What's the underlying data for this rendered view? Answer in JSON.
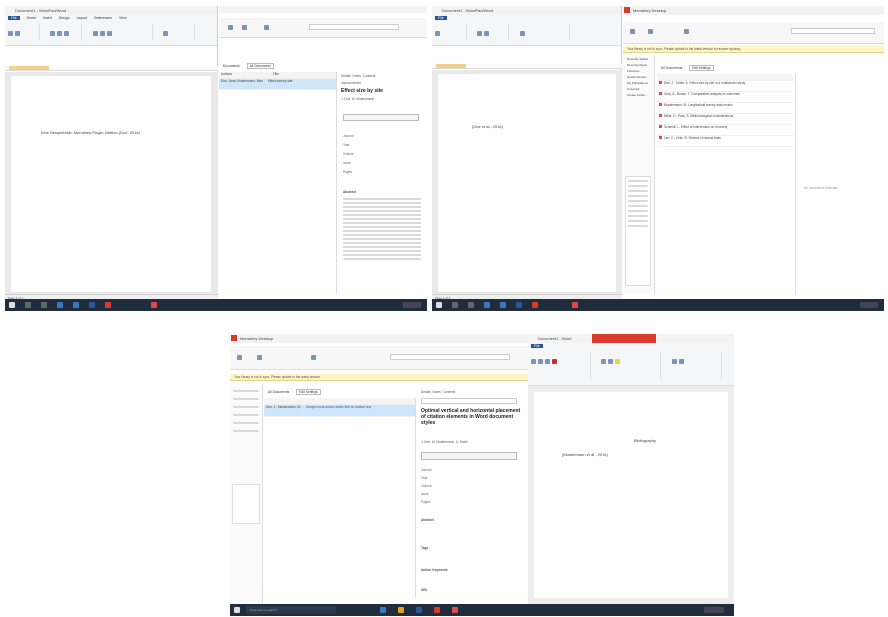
{
  "panel1": {
    "word_title": "Document1 - WordPad/Word",
    "word_tabs": [
      "File",
      "Home",
      "Insert",
      "Design",
      "Layout",
      "References",
      "Mailings",
      "Review",
      "View"
    ],
    "doc_text": "Eine Beispielzitat: Mendeley-Plugin Zitation (Doe, 2016)",
    "mendeley_tabs": [
      "Documents",
      "All Documents"
    ],
    "list_header": [
      "Authors",
      "Title"
    ],
    "list_row": {
      "authors": "Doe, Jane; Mustermann, Max",
      "title": "Effect size by site"
    },
    "details_tabs": [
      "Details",
      "Notes",
      "Contents"
    ],
    "details_title": "Effect size by site",
    "details_type": "Journal Article",
    "details_authors": "J. Doe, M. Mustermann",
    "details_fields": [
      "Journal",
      "Year",
      "Volume",
      "Issue",
      "Pages"
    ],
    "abstract_heading": "Abstract"
  },
  "panel2": {
    "word_title": "Document1 - WordPad/Word",
    "doc_text": "(Doe et al., 2016)",
    "mendeley_title": "Mendeley Desktop",
    "banner": "Your library is not in sync. Please update to the latest version to resume syncing.",
    "tabs": [
      "All Documents",
      "Edit Settings"
    ],
    "rows": [
      {
        "authors": "Doe, J.; Smith, A.",
        "title": "Effect size by site in a multicenter study"
      },
      {
        "authors": "Gray, A.; Brown, T.",
        "title": "Comparative analysis of outcomes"
      },
      {
        "authors": "Mustermann, M.",
        "title": "Longitudinal survey data review"
      },
      {
        "authors": "Miller, K.; Park, S.",
        "title": "Methodological considerations"
      },
      {
        "authors": "Schmidt, L.",
        "title": "Effect of intervention on recovery"
      },
      {
        "authors": "Lee, C.; Ortiz, R.",
        "title": "Review of clinical trials"
      }
    ],
    "no_docs_msg": "No documents selected",
    "sidebar": [
      "Recently Added",
      "Recently Read",
      "Favorites",
      "Needs Review",
      "My Publications",
      "Unsorted",
      "Create Folder..."
    ]
  },
  "panel3": {
    "mendeley_title": "Mendeley Desktop",
    "banner": "Your library is not in sync. Please update to the latest version.",
    "tabs": [
      "All Documents",
      "Edit Settings"
    ],
    "row": {
      "authors": "Doe, J.; Mustermann, M.",
      "title": "Sample multi-author article title for citation test"
    },
    "details_title": "Optimal vertical and horizontal placement of citation elements in Word document styles",
    "details_authors": "J. Doe, M. Mustermann, A. Smith",
    "details_fields": [
      "Journal",
      "Year",
      "Volume",
      "Issue",
      "Pages"
    ],
    "abstract_heading": "Abstract",
    "tags_heading": "Tags",
    "keywords_heading": "Author Keywords",
    "url_heading": "URL"
  },
  "panel4": {
    "word_title": "Document1 - Word",
    "doc_heading": "Bibliography",
    "doc_text": "(Mustermann et al., 2016)"
  },
  "taskbar": {
    "search_placeholder": "Type here to search"
  },
  "colors": {
    "word_blue": "#2b579a",
    "mendeley_red": "#d83b2c",
    "taskbar": "#1f2d3d",
    "highlight": "#cde6fb",
    "banner": "#fff4c6"
  }
}
